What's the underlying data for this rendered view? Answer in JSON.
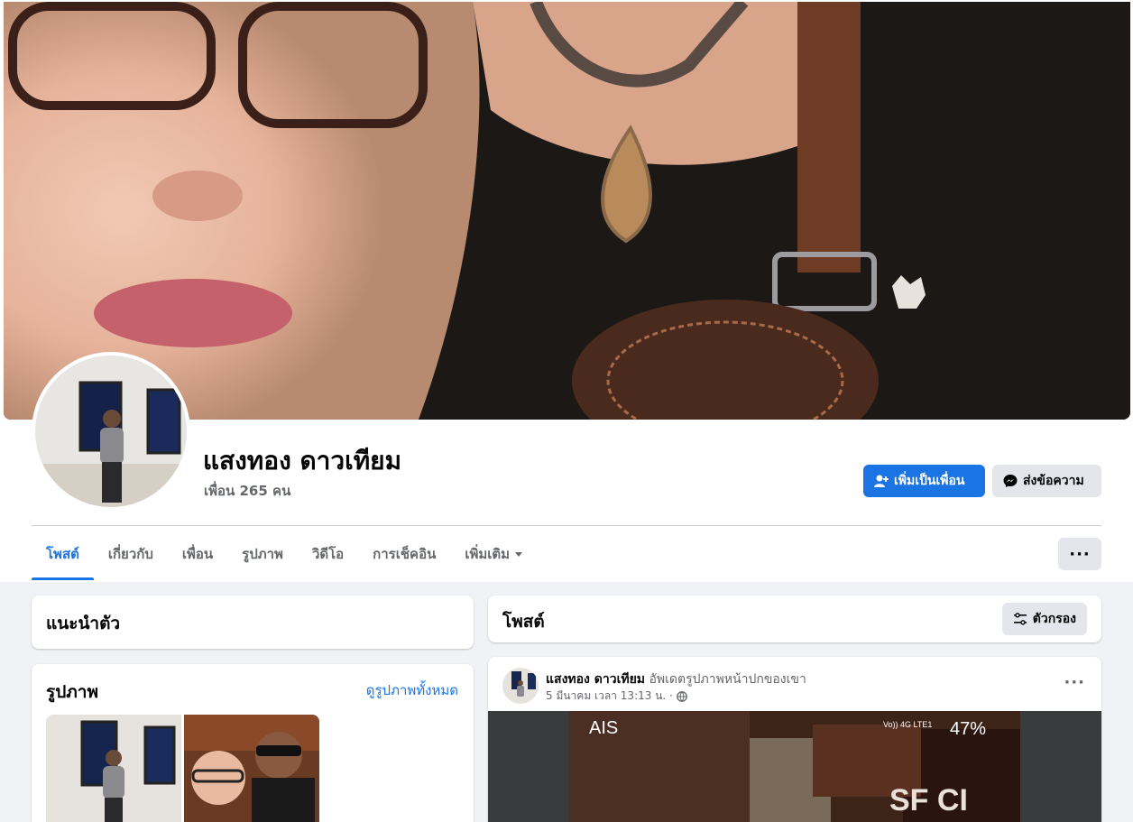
{
  "profile": {
    "name": "แสงทอง ดาวเทียม",
    "friends": "เพื่อน 265 คน"
  },
  "actions": {
    "add_friend": "เพิ่มเป็นเพื่อน",
    "message": "ส่งข้อความ"
  },
  "tabs": [
    {
      "label": "โพสต์",
      "active": true
    },
    {
      "label": "เกี่ยวกับ"
    },
    {
      "label": "เพื่อน"
    },
    {
      "label": "รูปภาพ"
    },
    {
      "label": "วิดีโอ"
    },
    {
      "label": "การเช็คอิน"
    },
    {
      "label": "เพิ่มเติม"
    }
  ],
  "more_label": "···",
  "intro": {
    "title": "แนะนำตัว"
  },
  "photos": {
    "title": "รูปภาพ",
    "see_all": "ดูรูปภาพทั้งหมด"
  },
  "posts": {
    "title": "โพสต์",
    "filter": "ตัวกรอง"
  },
  "post": {
    "author": "แสงทอง ดาวเทียม",
    "action": "อัพเดตรูปภาพหน้าปกของเขา",
    "time": "5 มีนาคม เวลา 13:13 น. ·",
    "dots": "···",
    "image_texts": {
      "carrier": "AIS",
      "battery": "47%",
      "network": "Vo)) 4G LTE1",
      "sign": "SF CI"
    }
  },
  "colors": {
    "accent": "#1b74e4",
    "page_bg": "#f0f2f5",
    "secondary_text": "#65676b"
  }
}
